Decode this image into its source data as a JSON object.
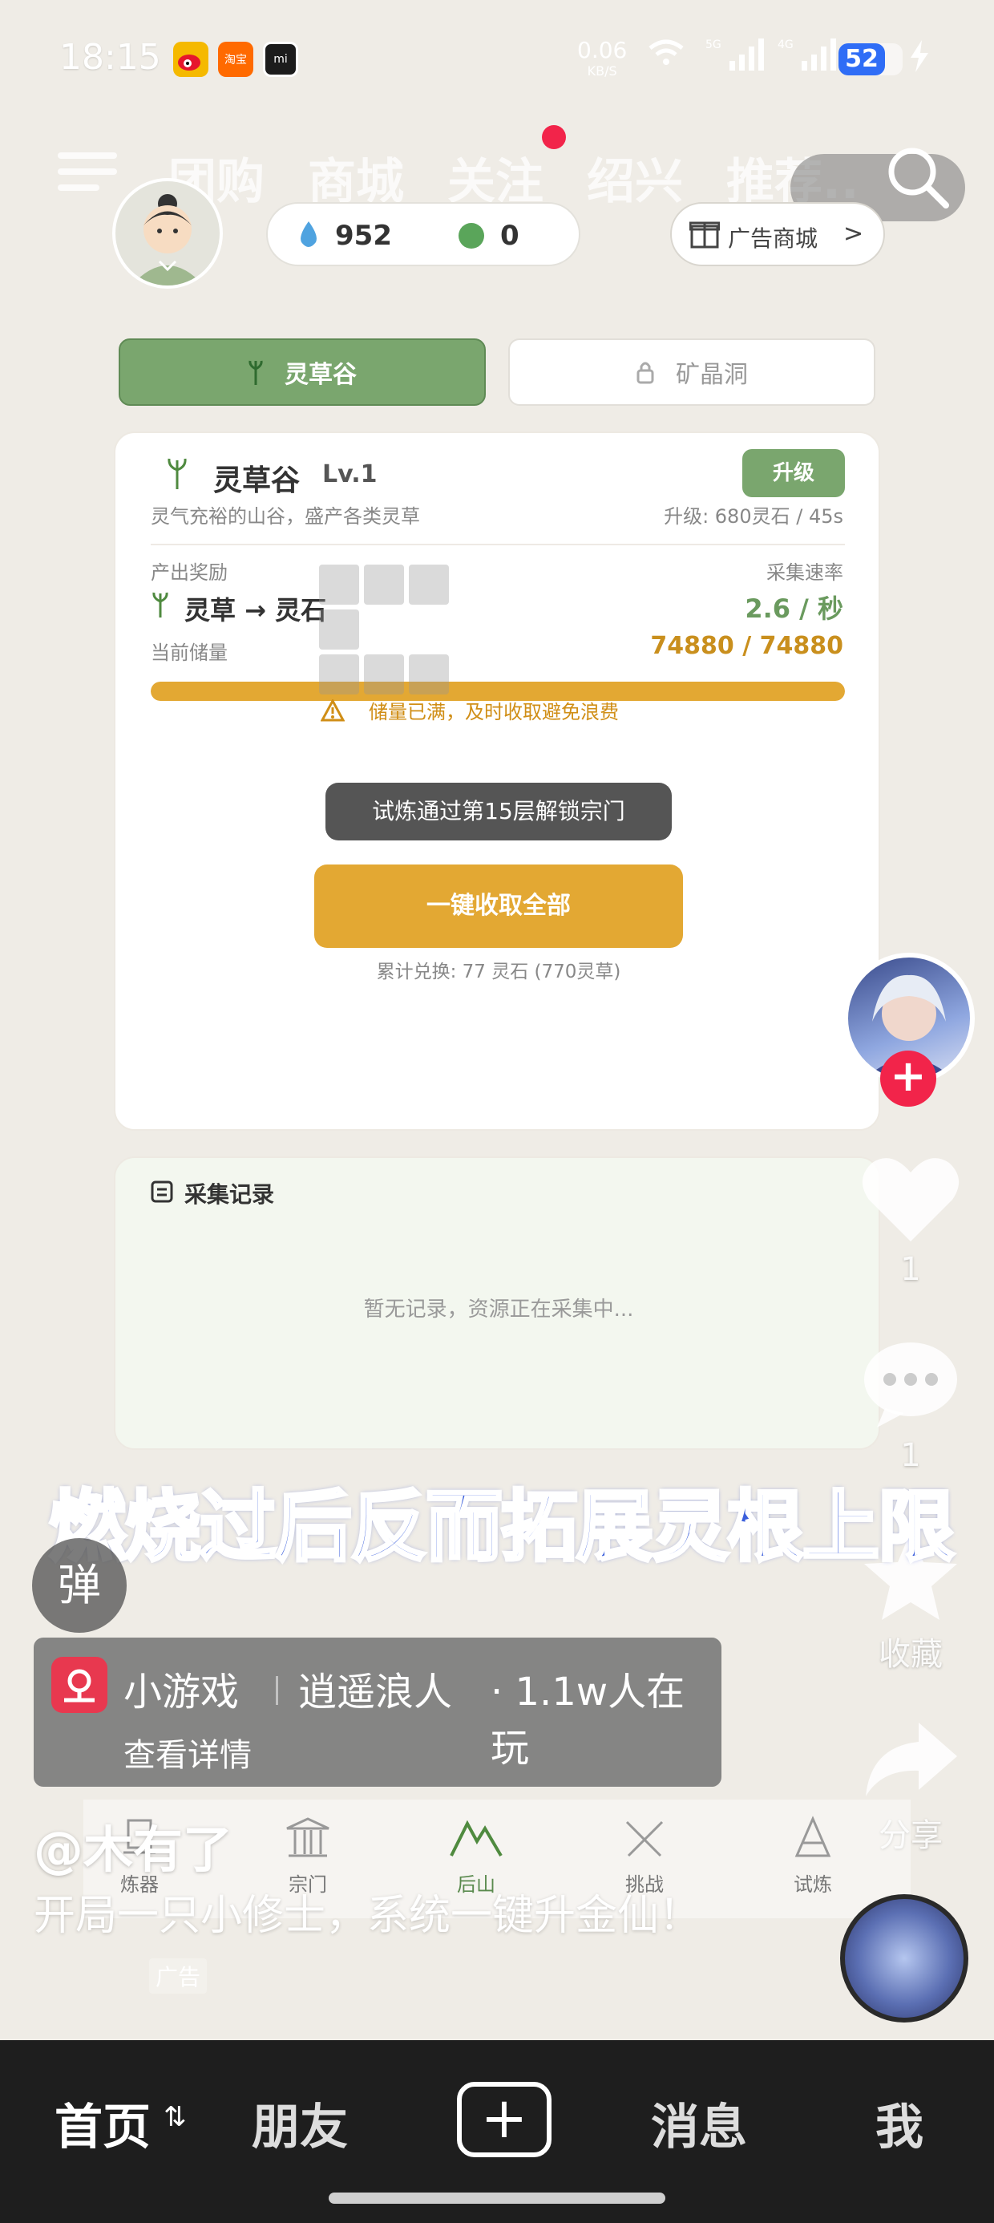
{
  "status_bar": {
    "time": "18:15",
    "net_speed": "0.06",
    "net_unit": "KB/S",
    "battery": "52",
    "apps": [
      "weibo",
      "taobao-flash",
      "xiaomi"
    ]
  },
  "top_tabs": [
    "团购",
    "商城",
    "关注",
    "绍兴",
    "推荐.."
  ],
  "game": {
    "spirit_water": "952",
    "green_orbs": "0",
    "shop_label": "广告商城",
    "shop_chevron": ">",
    "area_tabs": {
      "active": "灵草谷",
      "locked": "矿晶洞"
    },
    "card": {
      "title": "灵草谷",
      "level": "Lv.1",
      "description": "灵气充裕的山谷，盛产各类灵草",
      "upgrade_button": "升级",
      "upgrade_cost": "升级: 680灵石 / 45s",
      "reward_label": "产出奖励",
      "reward_value": "灵草 → 灵石",
      "speed_label": "采集速率",
      "speed_value": "2.6 / 秒",
      "storage_label": "当前储量",
      "storage_value": "74880 / 74880",
      "storage_fraction": 1.0,
      "warning": "储量已满，及时收取避免浪费",
      "toast": "试炼通过第15层解锁宗门",
      "collect_button": "一键收取全部",
      "exchange_total": "累计兑换: 77 灵石 (770灵草)"
    },
    "records": {
      "title": "采集记录",
      "empty": "暂无记录，资源正在采集中..."
    },
    "nav": [
      "炼器",
      "宗门",
      "后山",
      "挑战",
      "试炼"
    ],
    "nav_active": "后山"
  },
  "actions": {
    "like_count": "1",
    "comment_count": "1",
    "favorite_label": "收藏",
    "share_label": "分享",
    "follow_plus": "+"
  },
  "caption": "燃烧过后反而拓展灵根上限",
  "danmu_label": "弹",
  "mini_game": {
    "type_label": "小游戏",
    "title": "逍遥浪人",
    "players": "· 1.1w人在玩",
    "details": "查看详情"
  },
  "post": {
    "author": "@木有了",
    "description": "开局一只小修士，系统一键升金仙！",
    "ad_tag": "广告"
  },
  "bottom_nav": {
    "home": "首页",
    "friends": "朋友",
    "create": "+",
    "messages": "消息",
    "me": "我"
  }
}
